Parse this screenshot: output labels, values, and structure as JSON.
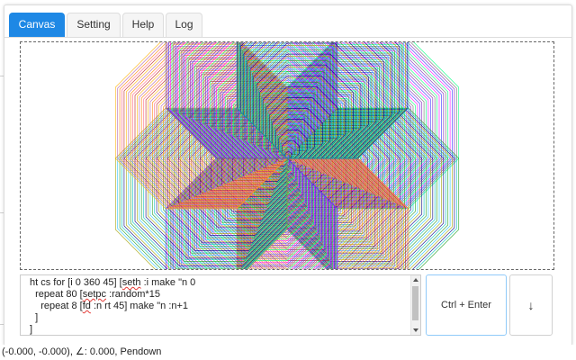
{
  "tabs": [
    {
      "label": "Canvas",
      "active": true
    },
    {
      "label": "Setting",
      "active": false
    },
    {
      "label": "Help",
      "active": false
    },
    {
      "label": "Log",
      "active": false
    }
  ],
  "editor": {
    "lines": [
      {
        "parts": [
          {
            "t": "ht cs for [i 0 360 45] [",
            "u": false
          },
          {
            "t": "seth",
            "u": true
          },
          {
            "t": " :i make \"n 0",
            "u": false
          }
        ]
      },
      {
        "parts": [
          {
            "t": "  repeat 80 [",
            "u": false
          },
          {
            "t": "setpc",
            "u": true
          },
          {
            "t": " :random*15",
            "u": false
          }
        ]
      },
      {
        "parts": [
          {
            "t": "    repeat 8 [",
            "u": false
          },
          {
            "t": "fd",
            "u": true
          },
          {
            "t": " :n rt 45] make \"n :n+1",
            "u": false
          }
        ]
      },
      {
        "parts": [
          {
            "t": "  ]",
            "u": false
          }
        ]
      },
      {
        "parts": [
          {
            "t": "]",
            "u": false
          }
        ]
      }
    ]
  },
  "buttons": {
    "run_label": "Ctrl + Enter",
    "down_label": "↓"
  },
  "status": {
    "text": "(-0.000, -0.000), ∠: 0.000, Pendown"
  },
  "drawing": {
    "program": "ht cs for [i 0 360 45] [seth :i make \"n 0 repeat 80 [setpc :random*15 repeat 8 [fd :n rt 45] make \"n :n+1] ]",
    "headings": [
      0,
      45,
      90,
      135,
      180,
      225,
      270,
      315
    ],
    "repeat_count": 80,
    "sides": 8,
    "turn_angle": 45,
    "palette": [
      "#ff00ff",
      "#00c0c0",
      "#ffb000",
      "#3030ff",
      "#20a020",
      "#c02020",
      "#8020c0",
      "#20c0ff",
      "#ff6080",
      "#707070",
      "#a0a000",
      "#ff8000",
      "#00ff80",
      "#000080",
      "#b060b0"
    ]
  }
}
